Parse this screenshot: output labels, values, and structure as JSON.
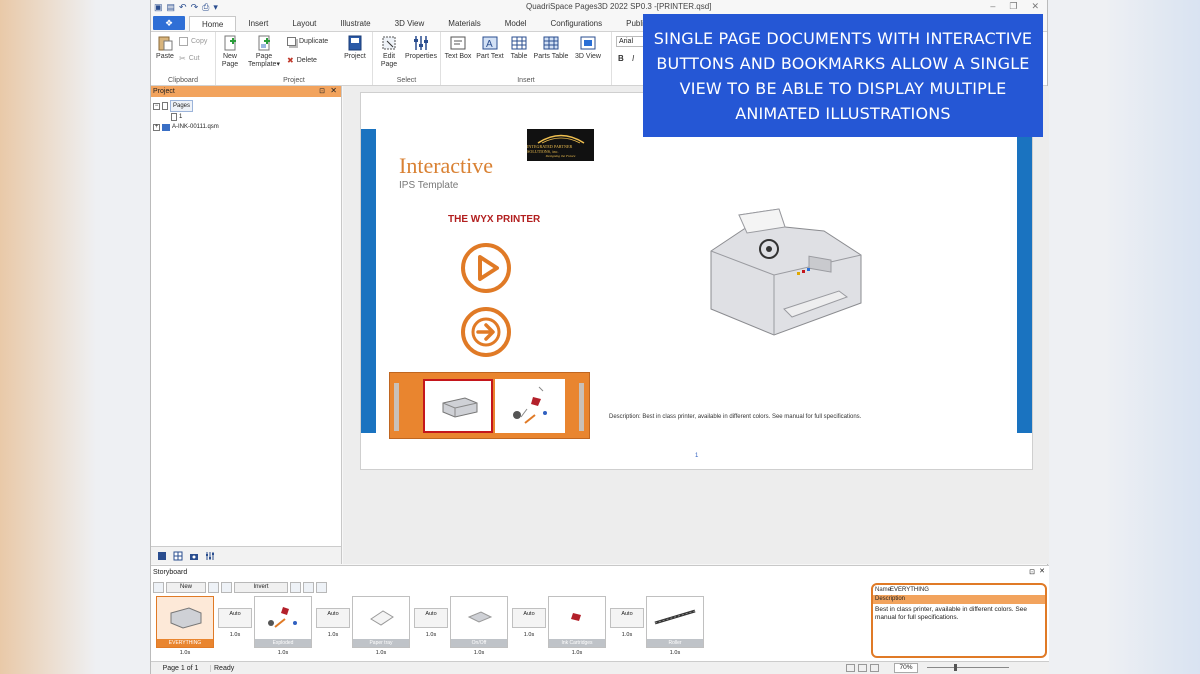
{
  "app": {
    "title": "QuadriSpace Pages3D  2022 SP0.3 -[PRINTER.qsd]",
    "file_button": "❖",
    "tabs": [
      "Home",
      "Insert",
      "Layout",
      "Illustrate",
      "3D View",
      "Materials",
      "Model",
      "Configurations",
      "Publish"
    ]
  },
  "ribbon": {
    "clipboard": {
      "label": "Clipboard",
      "paste": "Paste",
      "copy": "Copy",
      "cut": "Cut"
    },
    "project": {
      "label": "Project",
      "new_page_1": "New",
      "new_page_2": "Page",
      "page_template_1": "Page",
      "page_template_2": "Template",
      "duplicate": "Duplicate",
      "delete": "Delete",
      "project": "Project"
    },
    "select": {
      "label": "Select",
      "edit_page_1": "Edit",
      "edit_page_2": "Page",
      "properties": "Properties"
    },
    "insert": {
      "label": "Insert",
      "text_box": "Text Box",
      "part_text": "Part Text",
      "table": "Table",
      "parts_table": "Parts Table",
      "view_3d": "3D View"
    },
    "font": {
      "name": "Arial",
      "bold": "B",
      "italic": "I"
    }
  },
  "project_panel": {
    "title": "Project",
    "tree": {
      "pages": "Pages",
      "page_1": "1",
      "model": "A-INK-00111.qsm"
    }
  },
  "page": {
    "logo_line1": "INTEGRATED PARTNER SOLUTIONS, inc.",
    "logo_line2": "Designing the Future",
    "title": "Interactive",
    "subtitle": "IPS Template",
    "printer_title": "THE WYX PRINTER",
    "description": "Description: Best in class printer, available in different colors. See manual for full specifications.",
    "page_number": "1"
  },
  "overlay": {
    "text": "SINGLE PAGE DOCUMENTS WITH INTERACTIVE BUTTONS AND BOOKMARKS ALLOW A SINGLE VIEW TO BE ABLE TO DISPLAY MULTIPLE ANIMATED ILLUSTRATIONS"
  },
  "storyboard": {
    "title": "Storyboard",
    "new_label": "New",
    "invert_label": "Invert",
    "frames": [
      {
        "label": "EVERYTHING",
        "time": "1.0s"
      },
      {
        "label": "Exploded",
        "time": "1.0s"
      },
      {
        "label": "Paper tray",
        "time": "1.0s"
      },
      {
        "label": "On/Off",
        "time": "1.0s"
      },
      {
        "label": "Ink Cartridges",
        "time": "1.0s"
      },
      {
        "label": "Roller",
        "time": "1.0s"
      }
    ],
    "transitions": [
      {
        "label": "Auto",
        "time": "1.0s"
      },
      {
        "label": "Auto",
        "time": "1.0s"
      },
      {
        "label": "Auto",
        "time": "1.0s"
      },
      {
        "label": "Auto",
        "time": "1.0s"
      },
      {
        "label": "Auto",
        "time": "1.0s"
      }
    ],
    "props": {
      "name_label": "Name",
      "name_value": "EVERYTHING",
      "description_label": "Description",
      "description_value": "Best in class printer, available in different colors. See manual for full specifications."
    }
  },
  "status": {
    "page": "Page 1 of 1",
    "state": "Ready",
    "zoom": "70%"
  },
  "colors": {
    "accent": "#e07a26",
    "blue": "#1a73c0",
    "overlay": "#2557d5"
  }
}
